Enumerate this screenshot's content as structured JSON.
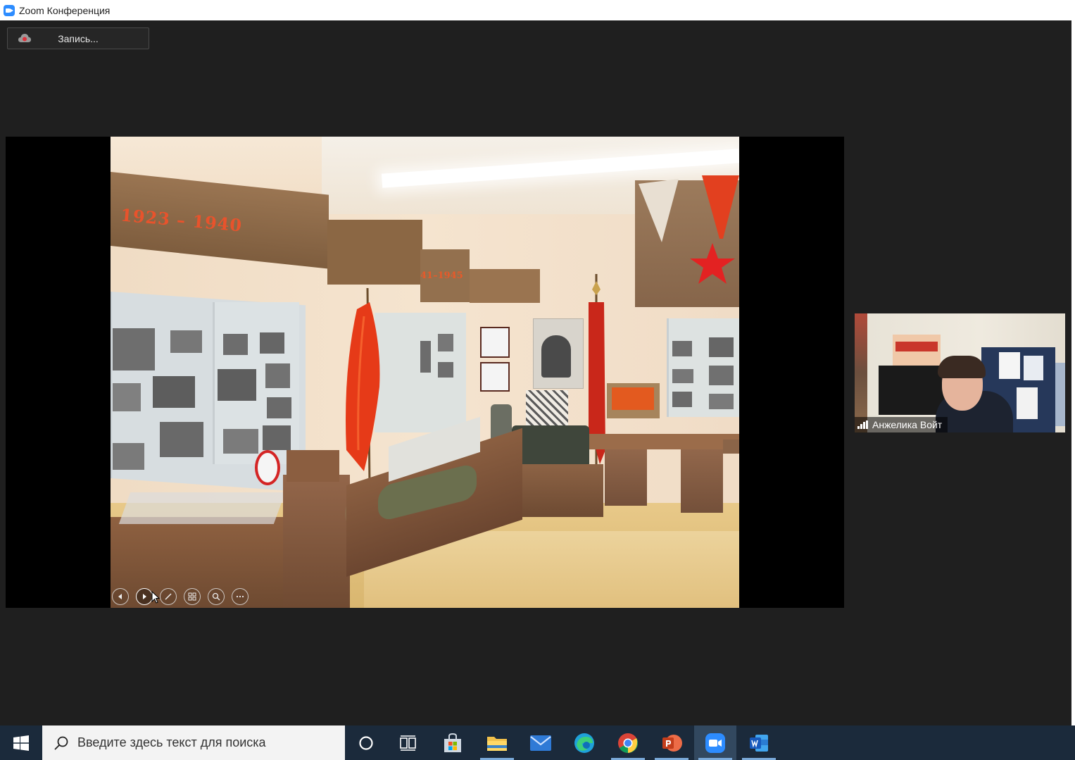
{
  "window": {
    "title": "Zoom Конференция"
  },
  "recording": {
    "label": "Запись..."
  },
  "slide": {
    "wall_text_1": "1923 – 1940",
    "wall_text_2": "41–1945",
    "controls": [
      "previous-slide",
      "next-slide",
      "pen",
      "see-all-slides",
      "zoom",
      "more-options"
    ]
  },
  "participant": {
    "name": "Анжелика Войт"
  },
  "taskbar": {
    "search_placeholder": "Введите здесь текст для поиска",
    "apps": [
      "cortana",
      "task-view",
      "microsoft-store",
      "file-explorer",
      "mail",
      "edge",
      "chrome",
      "powerpoint",
      "zoom",
      "word"
    ]
  },
  "colors": {
    "zoom_blue": "#2d8cff",
    "meeting_background": "#1f1f1f",
    "taskbar": "#1b2a3b"
  }
}
